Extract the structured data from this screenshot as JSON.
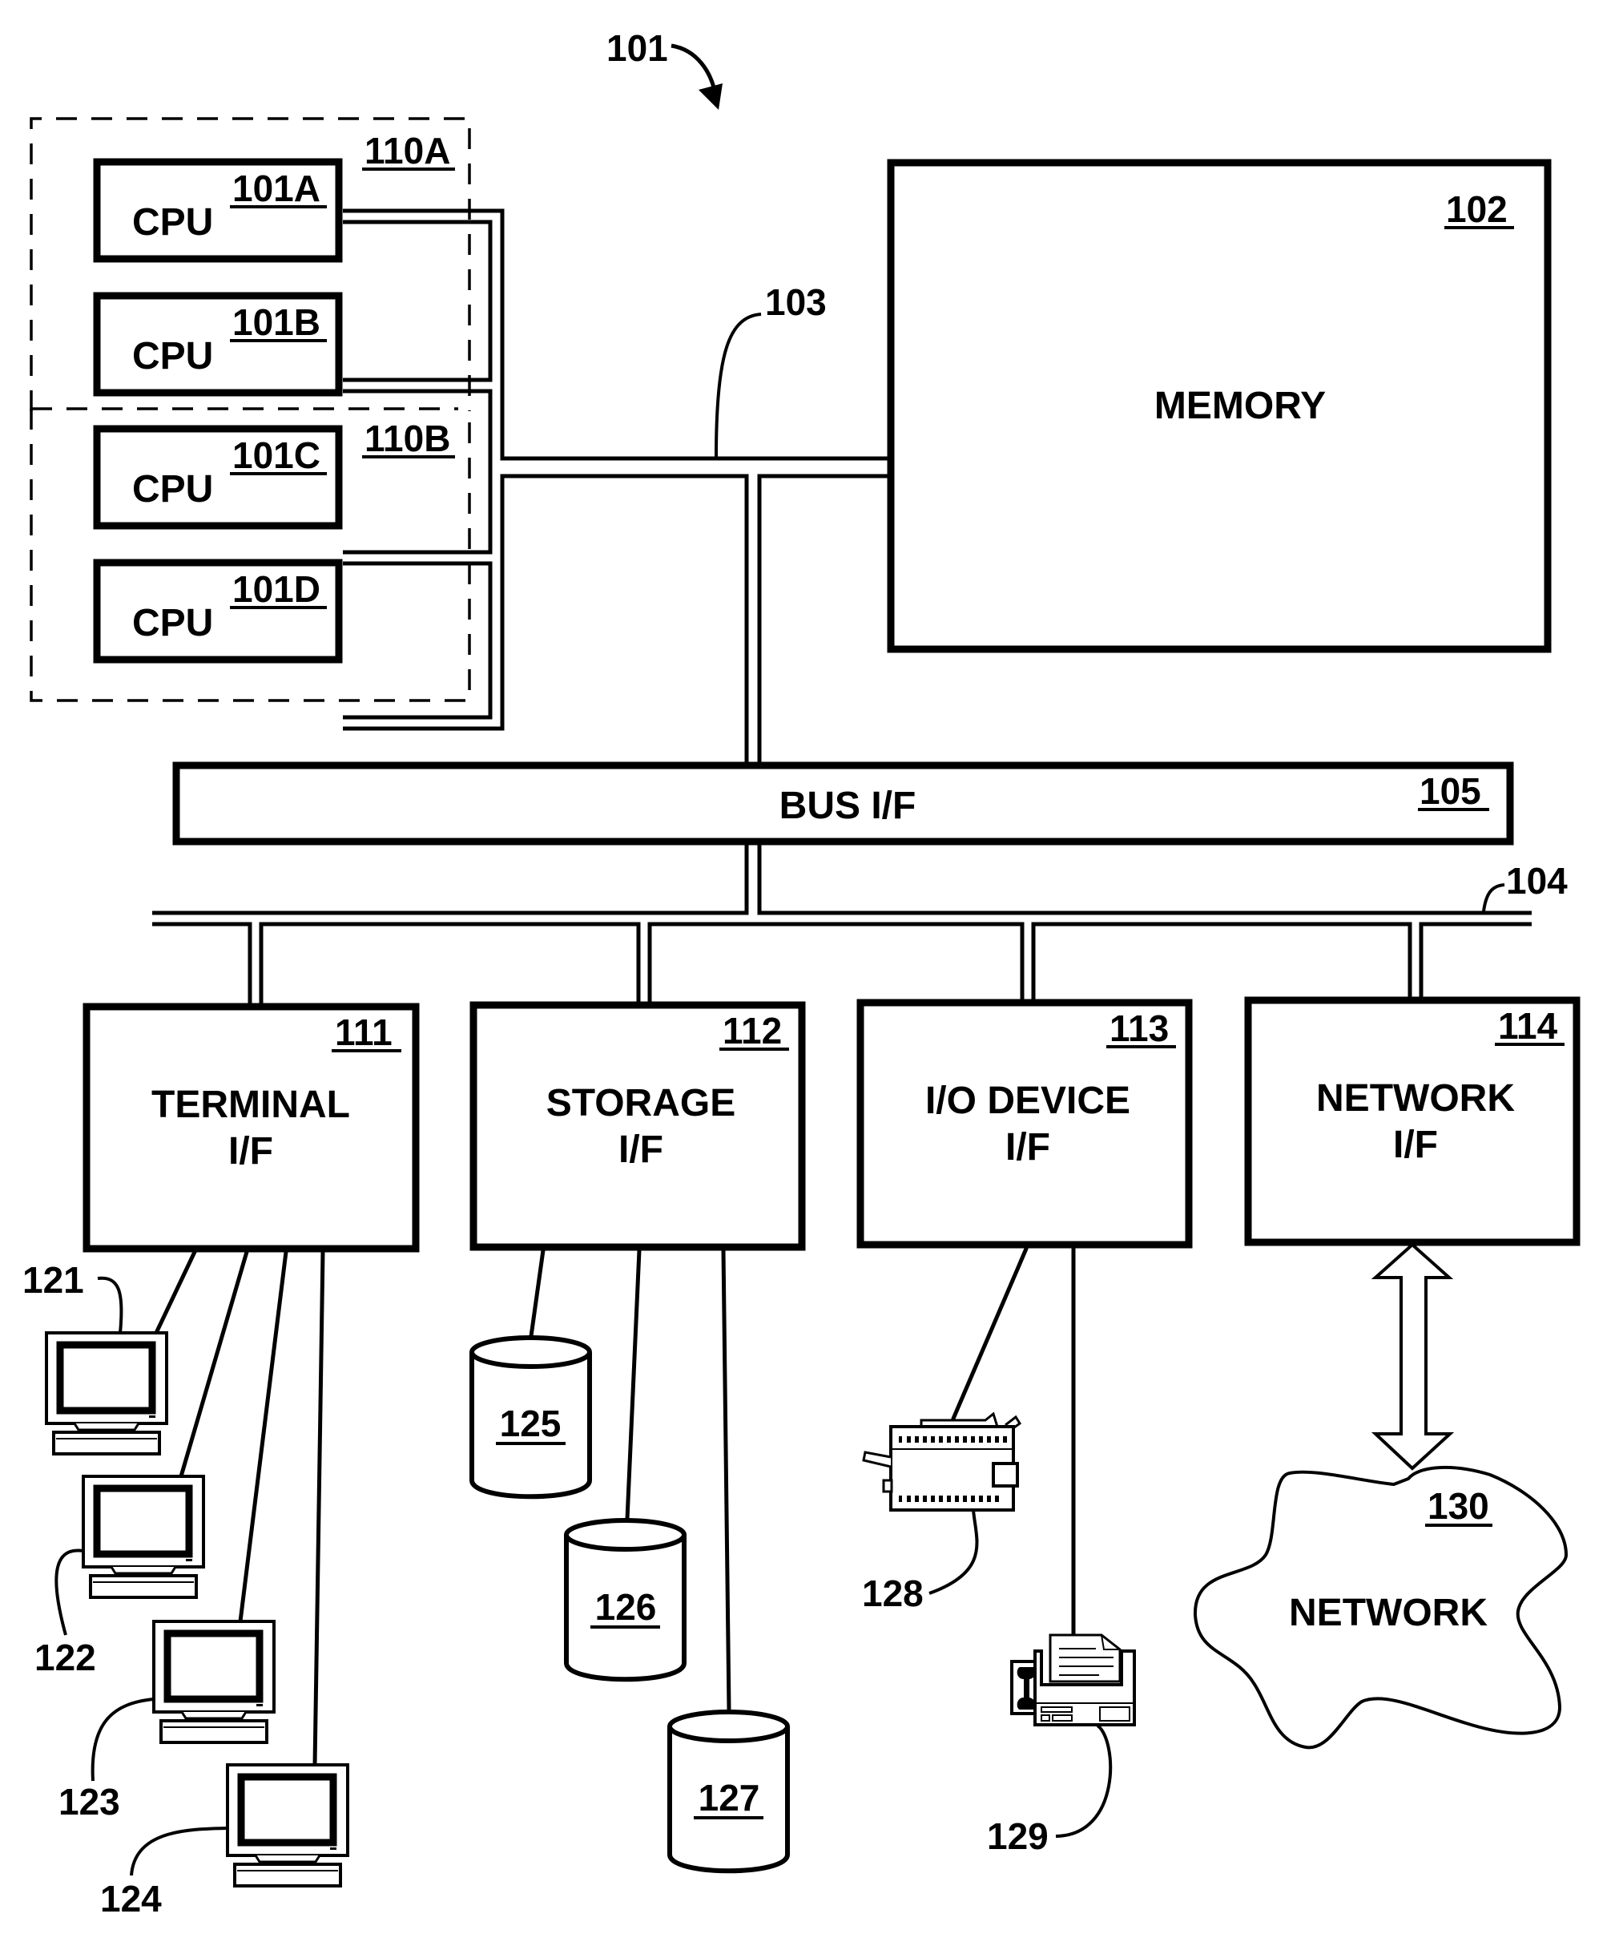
{
  "figure": {
    "reference": "101"
  },
  "cpu_groups": [
    {
      "id": "110A"
    },
    {
      "id": "110B"
    }
  ],
  "cpus": [
    {
      "label": "CPU",
      "id": "101A"
    },
    {
      "label": "CPU",
      "id": "101B"
    },
    {
      "label": "CPU",
      "id": "101C"
    },
    {
      "label": "CPU",
      "id": "101D"
    }
  ],
  "memory": {
    "label": "MEMORY",
    "id": "102"
  },
  "memory_bus": {
    "id": "103"
  },
  "io_bus": {
    "id": "104"
  },
  "bus_interface": {
    "label": "BUS I/F",
    "id": "105"
  },
  "interfaces": [
    {
      "line1": "TERMINAL",
      "line2": "I/F",
      "id": "111"
    },
    {
      "line1": "STORAGE",
      "line2": "I/F",
      "id": "112"
    },
    {
      "line1": "I/O DEVICE",
      "line2": "I/F",
      "id": "113"
    },
    {
      "line1": "NETWORK",
      "line2": "I/F",
      "id": "114"
    }
  ],
  "terminals": [
    {
      "id": "121",
      "icon": "computer-monitor-icon"
    },
    {
      "id": "122",
      "icon": "computer-monitor-icon"
    },
    {
      "id": "123",
      "icon": "computer-monitor-icon"
    },
    {
      "id": "124",
      "icon": "computer-monitor-icon"
    }
  ],
  "storage_devices": [
    {
      "id": "125",
      "icon": "disk-cylinder-icon"
    },
    {
      "id": "126",
      "icon": "disk-cylinder-icon"
    },
    {
      "id": "127",
      "icon": "disk-cylinder-icon"
    }
  ],
  "io_devices": [
    {
      "id": "128",
      "icon": "printer-icon"
    },
    {
      "id": "129",
      "icon": "fax-machine-icon"
    }
  ],
  "network": {
    "label": "NETWORK",
    "id": "130"
  },
  "colors": {
    "ink": "#000000",
    "paper": "#ffffff"
  }
}
